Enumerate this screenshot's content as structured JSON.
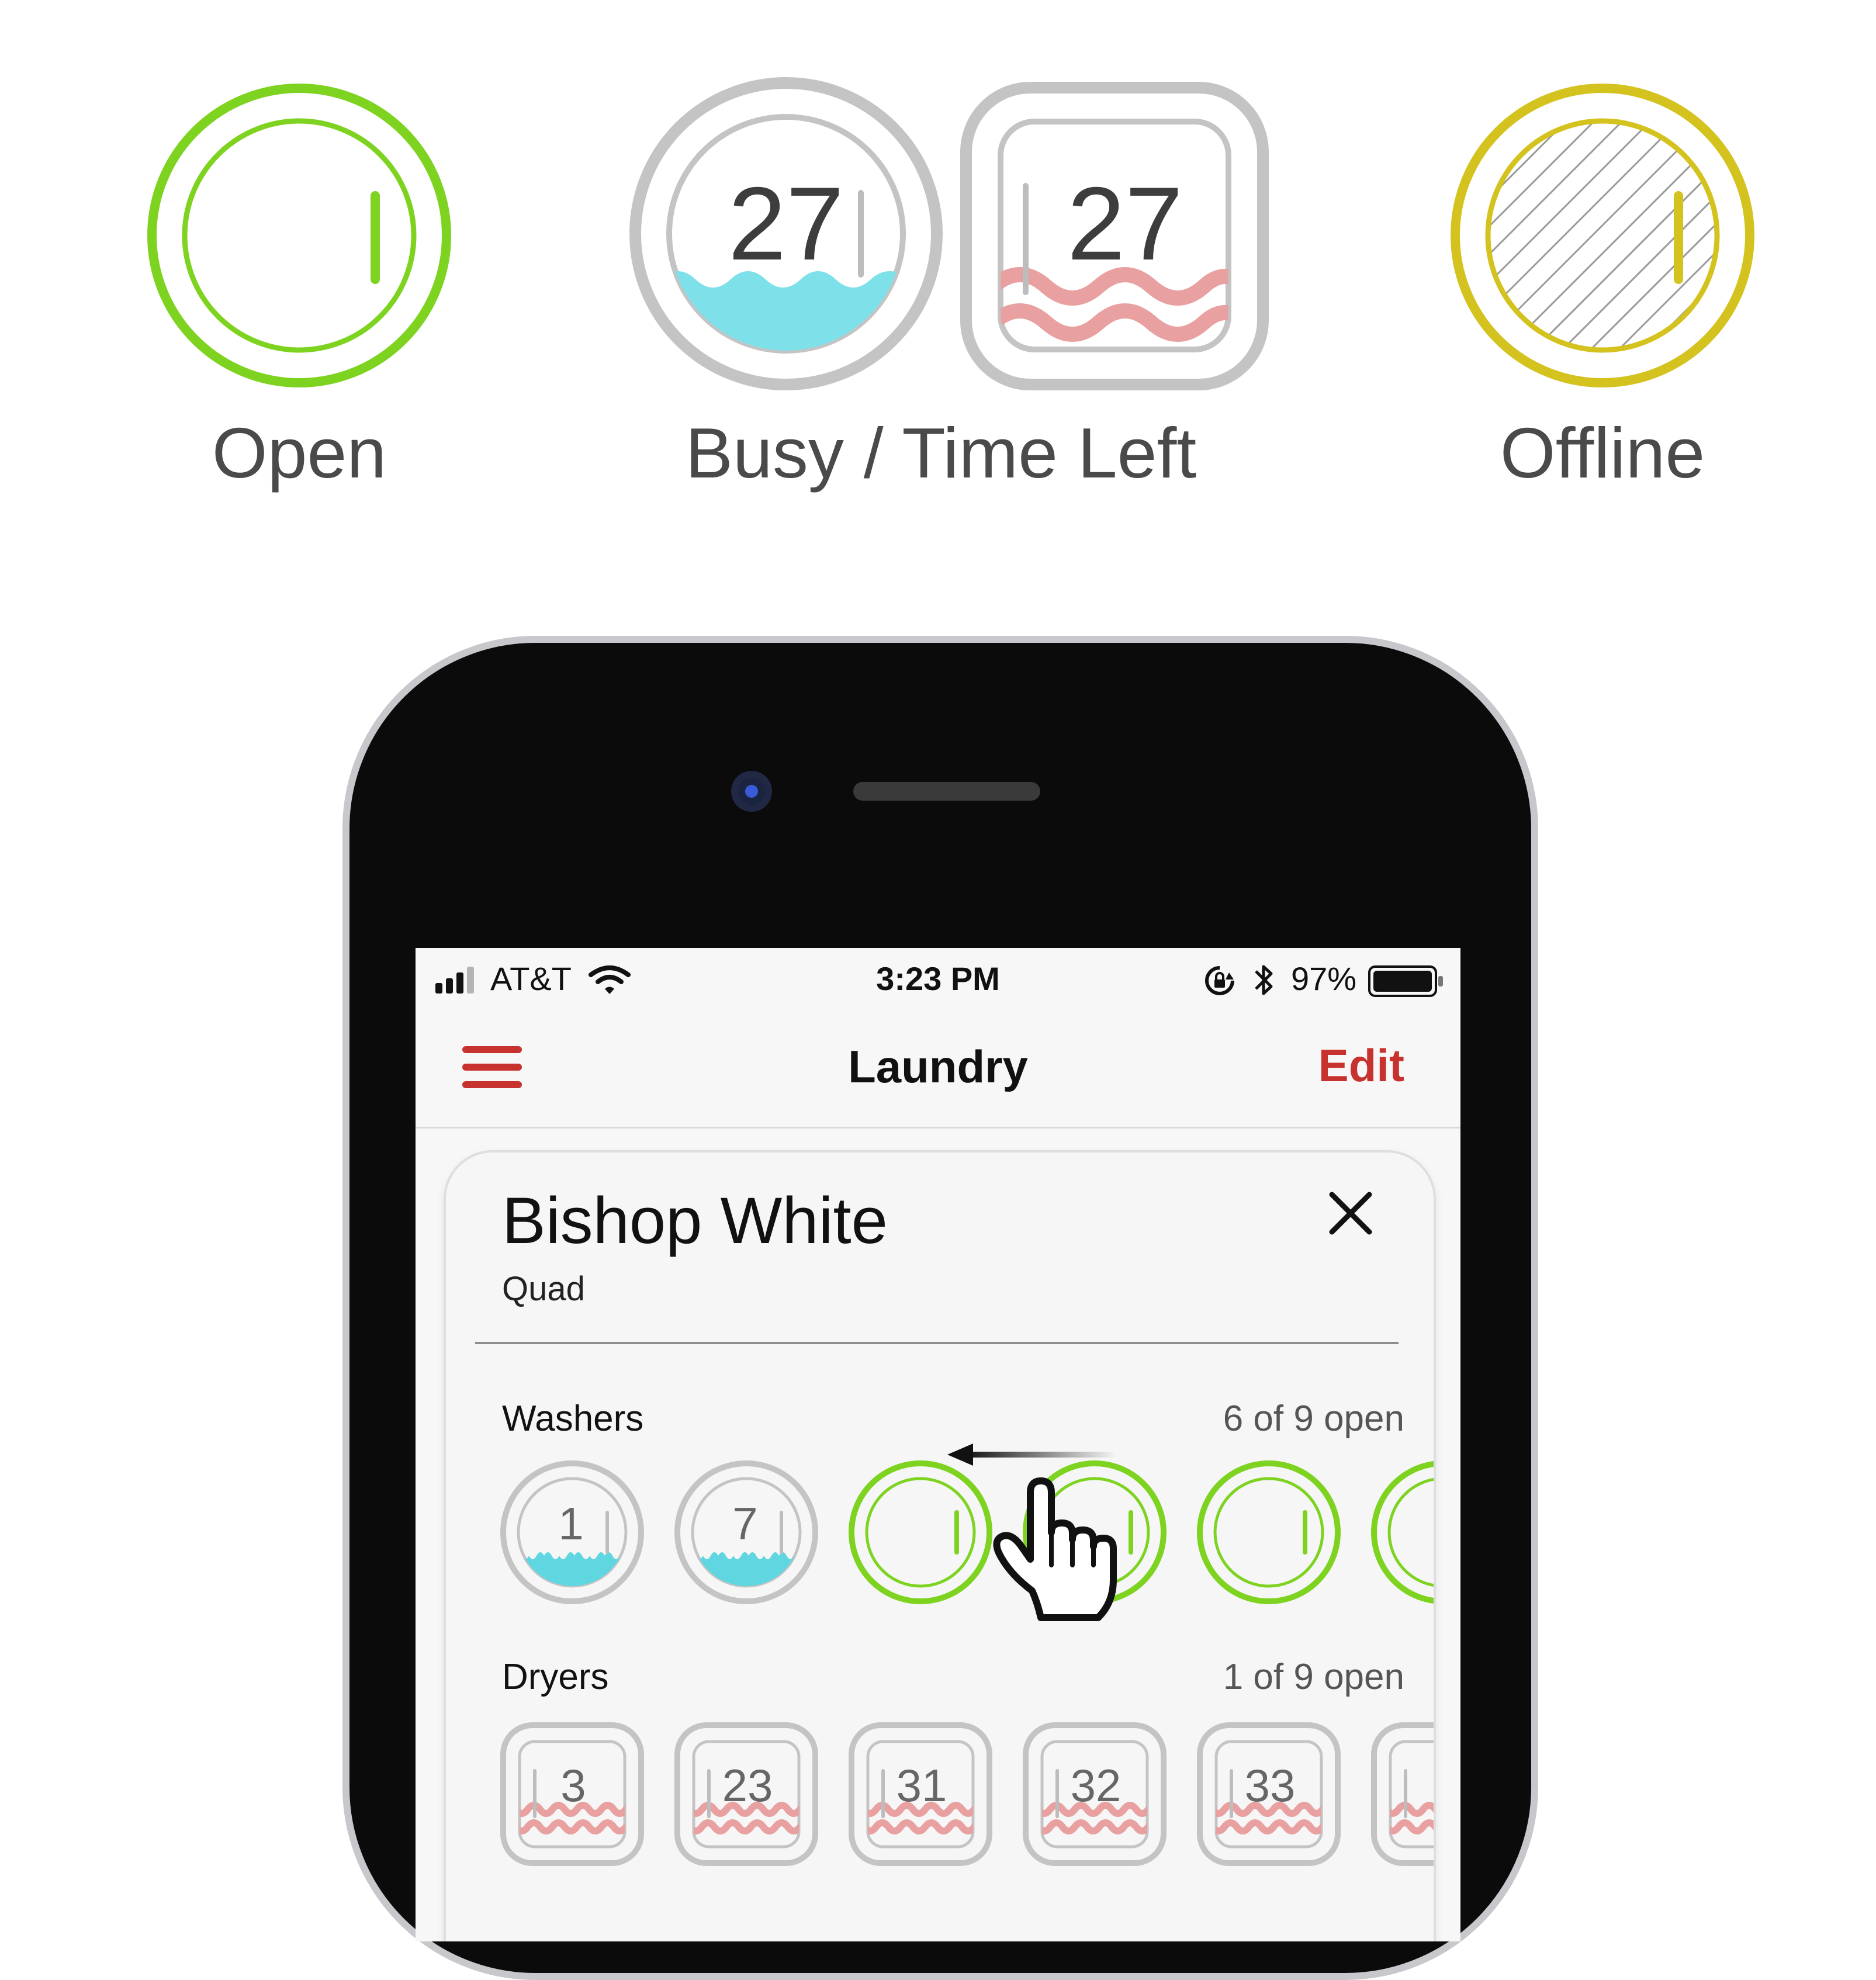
{
  "legend": {
    "open_label": "Open",
    "busy_label": "Busy / Time Left",
    "offline_label": "Offline",
    "busy_washer_minutes": "27",
    "busy_dryer_minutes": "27"
  },
  "colors": {
    "open_green": "#7ed321",
    "busy_gray": "#bdbdbd",
    "offline_yellow": "#d4c31f",
    "water_cyan": "#5fd6e0",
    "heat_pink": "#e8a0a0",
    "accent_red": "#c8322e"
  },
  "status_bar": {
    "carrier": "AT&T",
    "time": "3:23 PM",
    "battery": "97%"
  },
  "nav": {
    "title": "Laundry",
    "edit_label": "Edit"
  },
  "location": {
    "name": "Bishop White",
    "area": "Quad"
  },
  "washers": {
    "label": "Washers",
    "count_text": "6 of 9 open",
    "machines": [
      {
        "state": "busy",
        "number": "1"
      },
      {
        "state": "busy",
        "number": "7"
      },
      {
        "state": "open"
      },
      {
        "state": "open"
      },
      {
        "state": "open"
      },
      {
        "state": "open"
      }
    ]
  },
  "dryers": {
    "label": "Dryers",
    "count_text": "1 of 9 open",
    "machines": [
      {
        "state": "busy",
        "number": "3"
      },
      {
        "state": "busy",
        "number": "23"
      },
      {
        "state": "busy",
        "number": "31"
      },
      {
        "state": "busy",
        "number": "32"
      },
      {
        "state": "busy",
        "number": "33"
      },
      {
        "state": "busy"
      }
    ]
  },
  "icons": [
    "hamburger-menu-icon",
    "close-icon",
    "signal-icon",
    "wifi-icon",
    "rotation-lock-icon",
    "bluetooth-icon",
    "battery-icon",
    "hand-pointer-icon",
    "swipe-arrow-icon"
  ]
}
